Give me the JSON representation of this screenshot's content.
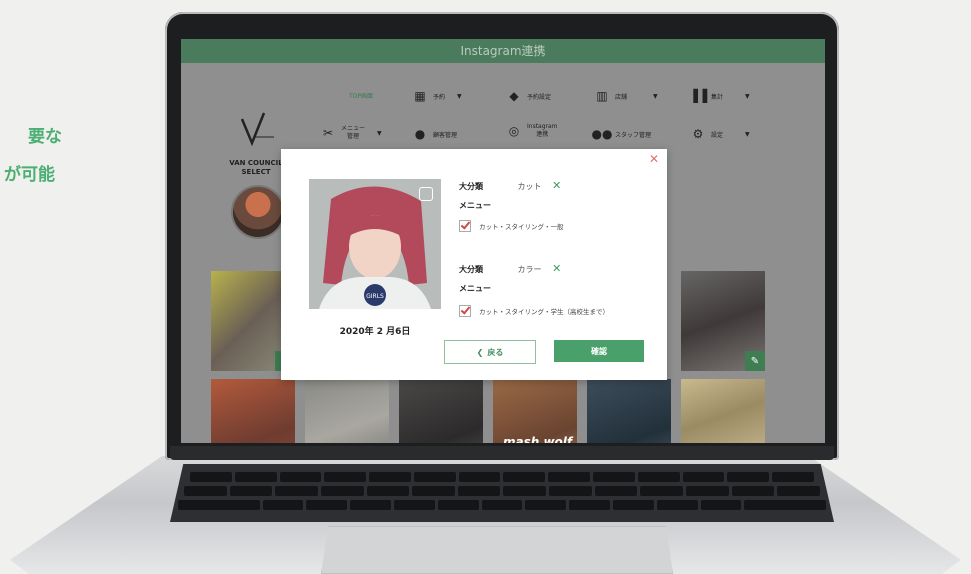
{
  "side_caption": {
    "line1": "要な",
    "line2": "が可能"
  },
  "app": {
    "title": "Instagram連携",
    "logo": {
      "line1": "VAN COUNCIL",
      "line2": "SELECT"
    },
    "nav": {
      "top": "TOP画面",
      "reservation": "予約",
      "reservation_settings": "予約設定",
      "store": "店舗",
      "aggregate": "集計",
      "menu_manage_1": "メニュー",
      "menu_manage_2": "管理",
      "customer_manage": "顧客管理",
      "instagram_1": "Instagram",
      "instagram_2": "連携",
      "staff_manage": "スタッフ管理",
      "settings": "設定"
    },
    "tile_text": {
      "mash_wolf": "mash wolf"
    }
  },
  "modal": {
    "date": "2020年 2 月6日",
    "categories": [
      {
        "label": "大分類",
        "value": "カット",
        "menu_label": "メニュー",
        "item": "カット・スタイリング・一般"
      },
      {
        "label": "大分類",
        "value": "カラー",
        "menu_label": "メニュー",
        "item": "カット・スタイリング・学生（高校生まで）"
      }
    ],
    "back_label": "戻る",
    "confirm_label": "確認",
    "photo_shirt_text": "GIRLS"
  },
  "colors": {
    "accent_green": "#4aa06a",
    "close_red": "#e0736d",
    "caption_green": "#4caf72"
  }
}
